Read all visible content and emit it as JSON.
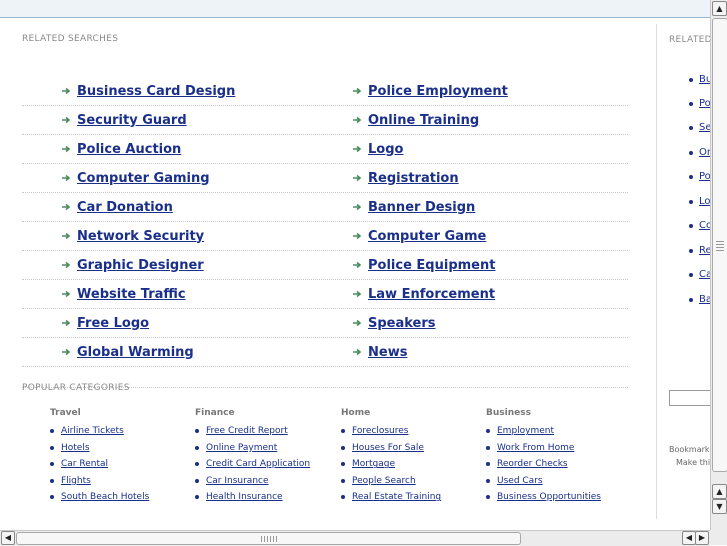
{
  "related_searches": {
    "title": "RELATED SEARCHES",
    "rows": [
      [
        "Business Card Design",
        "Police Employment"
      ],
      [
        "Security Guard",
        "Online Training"
      ],
      [
        "Police Auction",
        "Logo"
      ],
      [
        "Computer Gaming",
        "Registration"
      ],
      [
        "Car Donation",
        "Banner Design"
      ],
      [
        "Network Security",
        "Computer Game"
      ],
      [
        "Graphic Designer",
        "Police Equipment"
      ],
      [
        "Website Traffic",
        "Law Enforcement"
      ],
      [
        "Free Logo",
        "Speakers"
      ],
      [
        "Global Warming",
        "News"
      ]
    ]
  },
  "right_panel": {
    "title": "RELATED",
    "items": [
      "Bu",
      "Po",
      "Se",
      "On",
      "Po",
      "Lo",
      "Co",
      "Re",
      "Ca",
      "Ba"
    ],
    "bookmark_line1": "Bookmark",
    "bookmark_line2": "Make thi"
  },
  "popular_categories": {
    "title": "POPULAR CATEGORIES",
    "categories": [
      {
        "title": "Travel",
        "items": [
          "Airline Tickets",
          "Hotels",
          "Car Rental",
          "Flights",
          "South Beach Hotels"
        ]
      },
      {
        "title": "Finance",
        "items": [
          "Free Credit Report",
          "Online Payment",
          "Credit Card Application",
          "Car Insurance",
          "Health Insurance"
        ]
      },
      {
        "title": "Home",
        "items": [
          "Foreclosures",
          "Houses For Sale",
          "Mortgage",
          "People Search",
          "Real Estate Training"
        ]
      },
      {
        "title": "Business",
        "items": [
          "Employment",
          "Work From Home",
          "Reorder Checks",
          "Used Cars",
          "Business Opportunities"
        ]
      }
    ]
  },
  "colors": {
    "link": "#1a2f8a",
    "arrow": "#4a8a5e",
    "label": "#8a8a8a"
  },
  "icons": {
    "arrow": "arrow-right-icon",
    "scroll_up": "triangle-up-icon",
    "scroll_down": "triangle-down-icon",
    "scroll_left": "triangle-left-icon",
    "scroll_right": "triangle-right-icon"
  }
}
